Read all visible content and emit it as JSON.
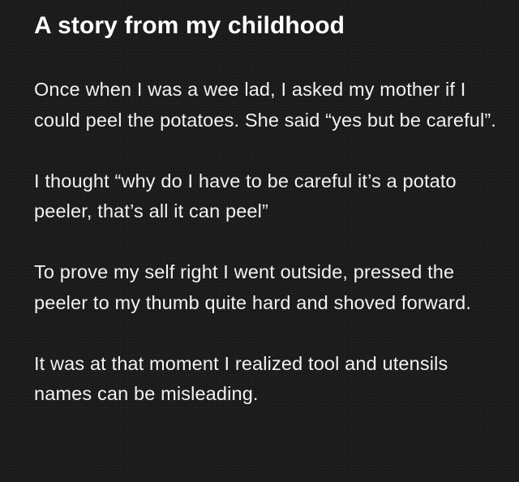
{
  "note": {
    "title": "A story from my childhood",
    "paragraphs": [
      "Once when I was a wee lad, I asked my mother if I could peel the potatoes. She said “yes but be careful”.",
      "I thought “why do I have to be careful it’s a potato peeler, that’s all it can peel”",
      "To prove my self right I went outside, pressed the peeler to my thumb quite hard and shoved forward.",
      "It was at that moment I realized tool and utensils names can be misleading."
    ]
  },
  "colors": {
    "background": "#1c1c1e",
    "text": "#ffffff"
  }
}
